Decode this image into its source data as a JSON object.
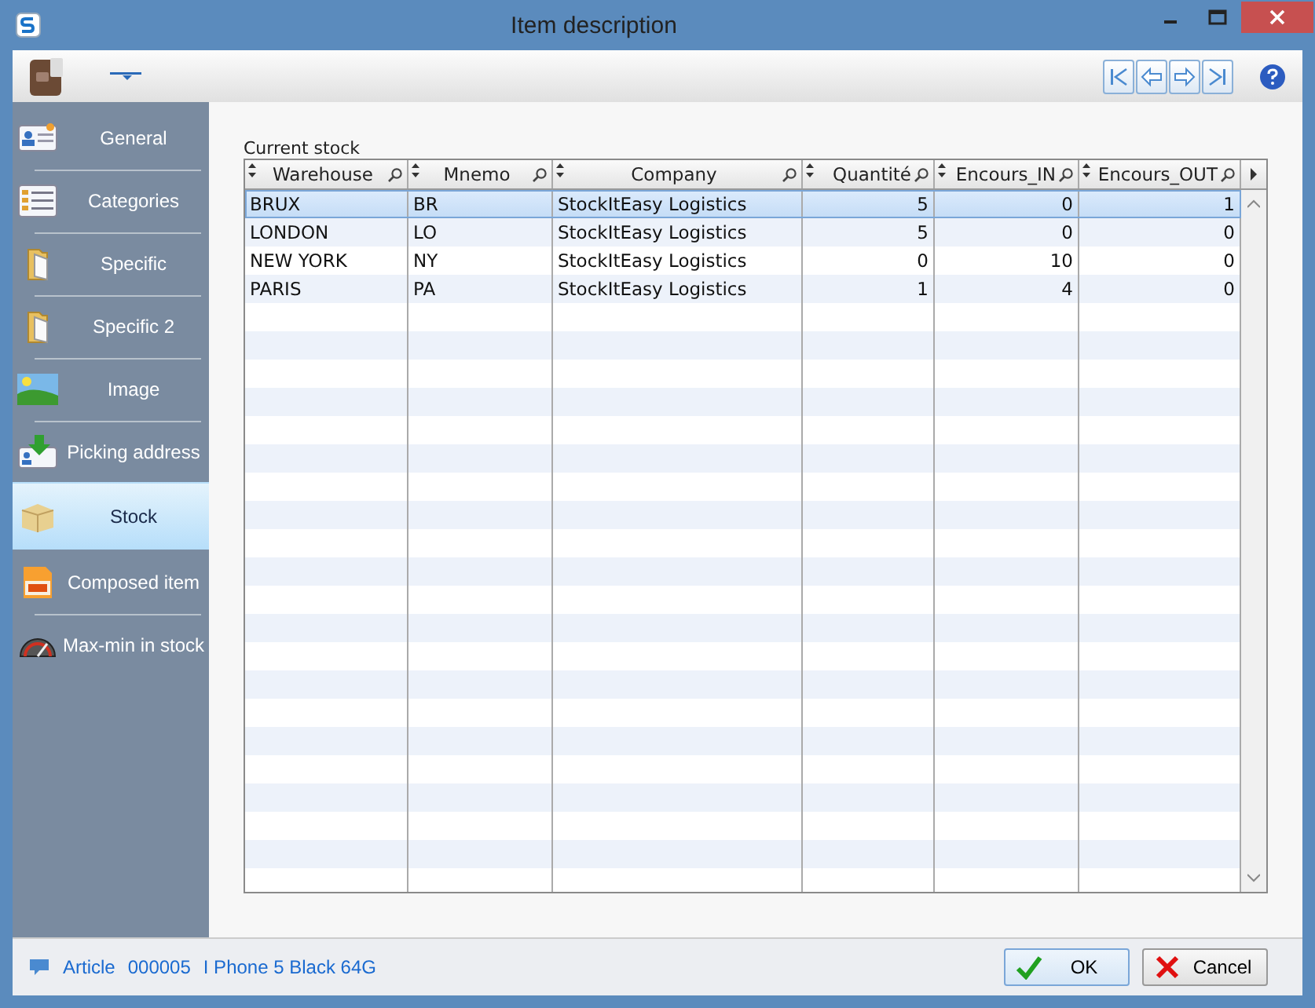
{
  "window": {
    "title": "Item description"
  },
  "sidebar": {
    "items": [
      {
        "label": "General",
        "selected": false
      },
      {
        "label": "Categories",
        "selected": false
      },
      {
        "label": "Specific",
        "selected": false
      },
      {
        "label": "Specific 2",
        "selected": false
      },
      {
        "label": "Image",
        "selected": false
      },
      {
        "label": "Picking address",
        "selected": false
      },
      {
        "label": "Stock",
        "selected": true
      },
      {
        "label": "Composed item",
        "selected": false
      },
      {
        "label": "Max-min in stock",
        "selected": false
      }
    ]
  },
  "section_title": "Current stock",
  "table": {
    "columns": [
      {
        "label": "Warehouse"
      },
      {
        "label": "Mnemo"
      },
      {
        "label": "Company"
      },
      {
        "label": "Quantité"
      },
      {
        "label": "Encours_IN"
      },
      {
        "label": "Encours_OUT"
      }
    ],
    "rows": [
      {
        "cells": [
          "BRUX",
          "BR",
          "StockItEasy Logistics",
          "5",
          "0",
          "1"
        ],
        "selected": true
      },
      {
        "cells": [
          "LONDON",
          "LO",
          "StockItEasy Logistics",
          "5",
          "0",
          "0"
        ],
        "selected": false
      },
      {
        "cells": [
          "NEW YORK",
          "NY",
          "StockItEasy Logistics",
          "0",
          "10",
          "0"
        ],
        "selected": false
      },
      {
        "cells": [
          "PARIS",
          "PA",
          "StockItEasy Logistics",
          "1",
          "4",
          "0"
        ],
        "selected": false
      }
    ]
  },
  "status": {
    "label": "Article",
    "code": "000005",
    "name": "I Phone 5 Black 64G"
  },
  "buttons": [
    {
      "label": "OK",
      "kind": "ok"
    },
    {
      "label": "Cancel",
      "kind": "cancel"
    }
  ]
}
